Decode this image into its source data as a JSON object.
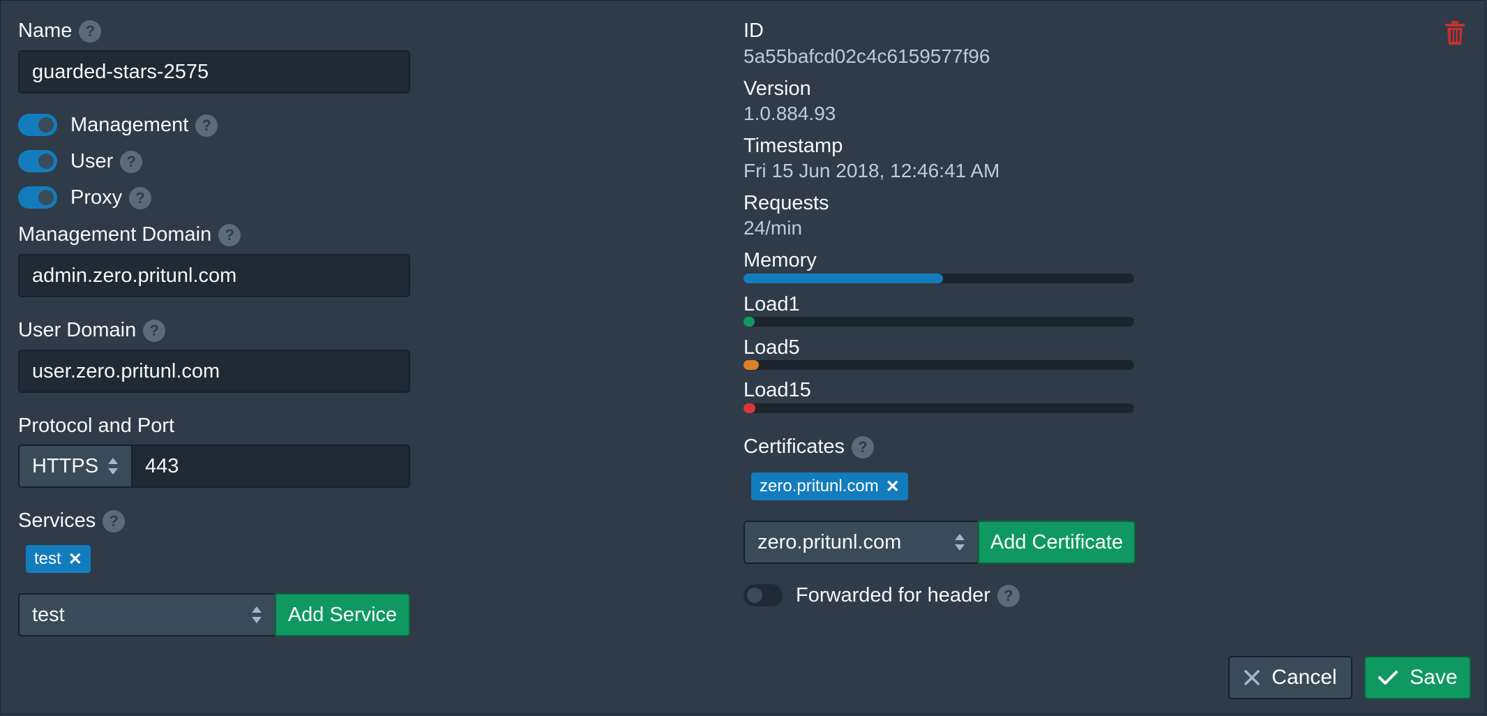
{
  "left": {
    "name": {
      "label": "Name",
      "value": "guarded-stars-2575"
    },
    "toggles": [
      {
        "label": "Management",
        "on": true
      },
      {
        "label": "User",
        "on": true
      },
      {
        "label": "Proxy",
        "on": true
      }
    ],
    "management_domain": {
      "label": "Management Domain",
      "value": "admin.zero.pritunl.com"
    },
    "user_domain": {
      "label": "User Domain",
      "value": "user.zero.pritunl.com"
    },
    "protocol_port": {
      "label": "Protocol and Port",
      "protocol": "HTTPS",
      "port": "443"
    },
    "services": {
      "label": "Services",
      "tags": [
        "test"
      ],
      "selected": "test",
      "add_label": "Add Service"
    }
  },
  "right": {
    "id": {
      "label": "ID",
      "value": "5a55bafcd02c4c6159577f96"
    },
    "version": {
      "label": "Version",
      "value": "1.0.884.93"
    },
    "timestamp": {
      "label": "Timestamp",
      "value": "Fri 15 Jun 2018, 12:46:41 AM"
    },
    "requests": {
      "label": "Requests",
      "value": "24/min"
    },
    "meters": [
      {
        "label": "Memory",
        "fraction": 0.51,
        "color": "#137cbd"
      },
      {
        "label": "Load1",
        "fraction": 0.02,
        "color": "#0f9960"
      },
      {
        "label": "Load5",
        "fraction": 0.04,
        "color": "#d9822b"
      },
      {
        "label": "Load15",
        "fraction": 0.03,
        "color": "#db3737"
      }
    ],
    "certificates": {
      "label": "Certificates",
      "tags": [
        "zero.pritunl.com"
      ],
      "selected": "zero.pritunl.com",
      "add_label": "Add Certificate"
    },
    "forwarded": {
      "label": "Forwarded for header",
      "on": false
    }
  },
  "footer": {
    "cancel_label": "Cancel",
    "save_label": "Save"
  },
  "icons": {
    "delete": "trash-icon",
    "help": "question-circle-icon"
  },
  "colors": {
    "primary": "#137cbd",
    "success": "#0f9960",
    "danger": "#db3737",
    "background": "#2f3b48"
  }
}
